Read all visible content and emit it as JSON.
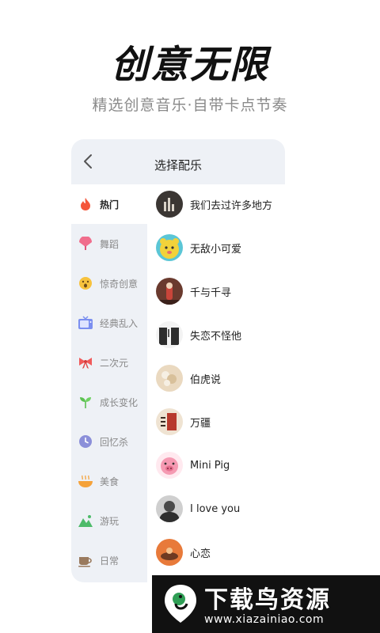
{
  "headline": "创意无限",
  "subheadline": "精选创意音乐·自带卡点节奏",
  "panel": {
    "title": "选择配乐",
    "back_icon": "chevron-left-icon"
  },
  "categories": [
    {
      "label": "热门",
      "icon": "flame-icon",
      "color": "#f4553a",
      "active": true
    },
    {
      "label": "舞蹈",
      "icon": "fan-icon",
      "color": "#f06d8c"
    },
    {
      "label": "惊奇创意",
      "icon": "surprised-face-icon",
      "color": "#f7c23d"
    },
    {
      "label": "经典乱入",
      "icon": "tv-icon",
      "color": "#7b8ff0"
    },
    {
      "label": "二次元",
      "icon": "bow-icon",
      "color": "#f05a5a"
    },
    {
      "label": "成长变化",
      "icon": "sprout-icon",
      "color": "#5cc151"
    },
    {
      "label": "回忆杀",
      "icon": "clock-icon",
      "color": "#8b8fd9"
    },
    {
      "label": "美食",
      "icon": "bowl-icon",
      "color": "#f5a23a"
    },
    {
      "label": "游玩",
      "icon": "mountain-icon",
      "color": "#4dbb6a"
    },
    {
      "label": "日常",
      "icon": "cup-icon",
      "color": "#9a7a5e"
    }
  ],
  "songs": [
    {
      "title": "我们去过许多地方",
      "cover": "#3b3633"
    },
    {
      "title": "无敌小可爱",
      "cover": "#f2d23a"
    },
    {
      "title": "千与千寻",
      "cover": "#6a3a2e"
    },
    {
      "title": "失恋不怪他",
      "cover": "#2d2d2d"
    },
    {
      "title": "伯虎说",
      "cover": "#ead9c0"
    },
    {
      "title": "万疆",
      "cover": "#d8b48e"
    },
    {
      "title": "Mini Pig",
      "cover": "#f59ab2"
    },
    {
      "title": "I love you",
      "cover": "#4a4a4a"
    },
    {
      "title": "心恋",
      "cover": "#e87a3a"
    }
  ],
  "watermark": {
    "title": "下载鸟资源",
    "url": "www.xiazainiao.com"
  }
}
